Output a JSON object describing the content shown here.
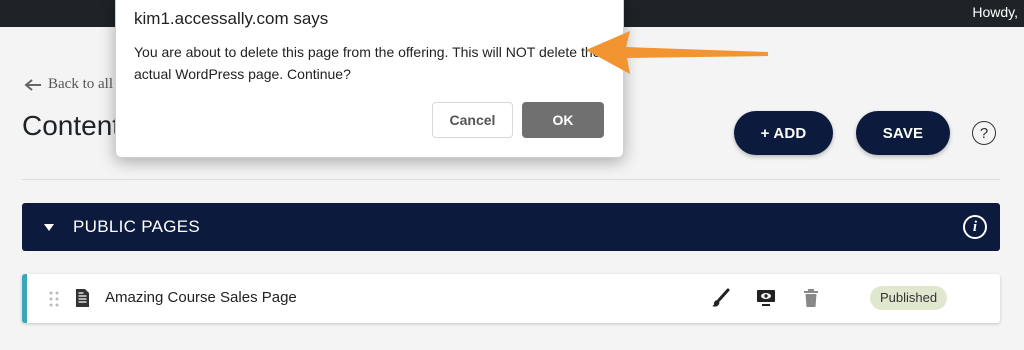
{
  "adminbar": {
    "greeting": "Howdy,"
  },
  "page": {
    "back_label": "Back to all",
    "title": "Content",
    "add_label": "+ ADD",
    "save_label": "SAVE",
    "help_label": "?"
  },
  "section": {
    "title": "PUBLIC PAGES",
    "info_label": "i"
  },
  "rows": [
    {
      "title": "Amazing Course Sales Page",
      "status": "Published",
      "status_color": "#dfe8cf",
      "accent_color": "#3ba6b8"
    }
  ],
  "dialog": {
    "title": "kim1.accessally.com says",
    "message": "You are about to delete this page from the offering. This will NOT delete the actual WordPress page. Continue?",
    "cancel_label": "Cancel",
    "ok_label": "OK"
  },
  "colors": {
    "navy": "#0b1a3d",
    "annotation_arrow": "#f29431"
  },
  "icons": [
    "arrow-left-icon",
    "help-icon",
    "caret-down-icon",
    "info-icon",
    "drag-handle-icon",
    "document-icon",
    "brush-icon",
    "preview-icon",
    "trash-icon",
    "annotation-arrow"
  ]
}
